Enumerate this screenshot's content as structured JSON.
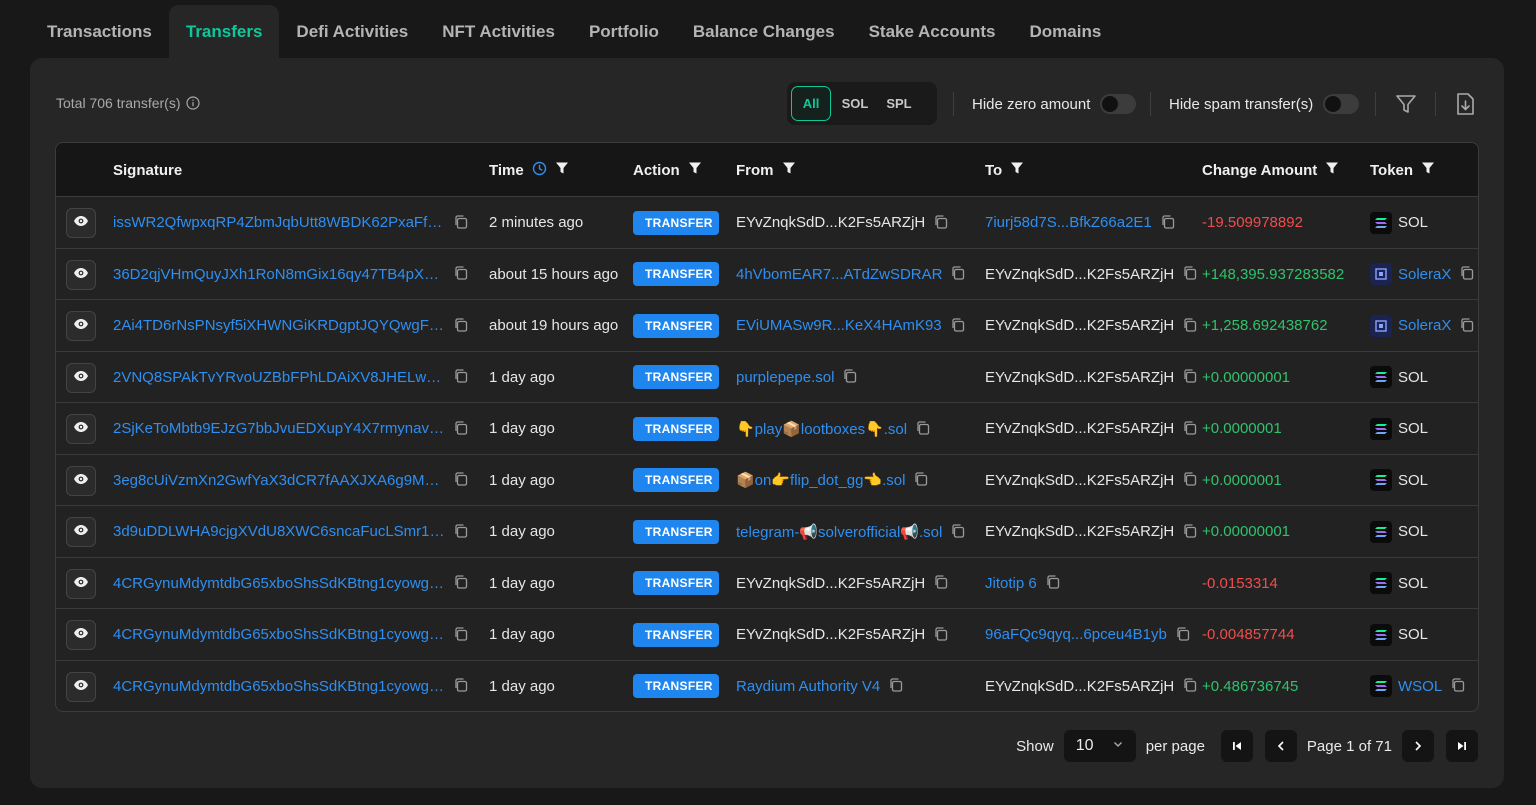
{
  "tabs": [
    {
      "label": "Transactions"
    },
    {
      "label": "Transfers",
      "active": true
    },
    {
      "label": "Defi Activities"
    },
    {
      "label": "NFT Activities"
    },
    {
      "label": "Portfolio"
    },
    {
      "label": "Balance Changes"
    },
    {
      "label": "Stake Accounts"
    },
    {
      "label": "Domains"
    }
  ],
  "toolbar": {
    "total": "Total 706 transfer(s)",
    "filters": [
      "All",
      "SOL",
      "SPL"
    ],
    "active_filter": "All",
    "hide_zero_label": "Hide zero amount",
    "hide_spam_label": "Hide spam transfer(s)",
    "hide_zero_on": false,
    "hide_spam_on": false
  },
  "columns": {
    "signature": "Signature",
    "time": "Time",
    "action": "Action",
    "from": "From",
    "to": "To",
    "amount": "Change Amount",
    "token": "Token"
  },
  "rows": [
    {
      "signature": "issWR2QfwpxqRP4ZbmJqbUtt8WBDK62PxaFfSU...",
      "time": "2 minutes ago",
      "action": "TRANSFER",
      "from": "EYvZnqkSdD...K2Fs5ARZjH",
      "from_link": false,
      "to": "7iurj58d7S...BfkZ66a2E1",
      "to_link": true,
      "amount": "-19.509978892",
      "sign": "neg",
      "token": "SOL",
      "token_link": false,
      "token_icon": "solana-icon"
    },
    {
      "signature": "36D2qjVHmQuyJXh1RoN8mGix16qy47TB4pXPA...",
      "time": "about 15 hours ago",
      "action": "TRANSFER",
      "from": "4hVbomEAR7...ATdZwSDRAR",
      "from_link": true,
      "to": "EYvZnqkSdD...K2Fs5ARZjH",
      "to_link": false,
      "amount": "+148,395.937283582",
      "sign": "pos",
      "token": "SoleraX",
      "token_link": true,
      "token_icon": "solerax-icon"
    },
    {
      "signature": "2Ai4TD6rNsPNsyf5iXHWNGiKRDgptJQYQwgFzvs...",
      "time": "about 19 hours ago",
      "action": "TRANSFER",
      "from": "EViUMASw9R...KeX4HAmK93",
      "from_link": true,
      "to": "EYvZnqkSdD...K2Fs5ARZjH",
      "to_link": false,
      "amount": "+1,258.692438762",
      "sign": "pos",
      "token": "SoleraX",
      "token_link": true,
      "token_icon": "solerax-icon"
    },
    {
      "signature": "2VNQ8SPAkTvYRvoUZBbFPhLDAiXV8JHELwuXA...",
      "time": "1 day ago",
      "action": "TRANSFER",
      "from": "purplepepe.sol",
      "from_link": true,
      "to": "EYvZnqkSdD...K2Fs5ARZjH",
      "to_link": false,
      "amount": "+0.00000001",
      "sign": "pos",
      "token": "SOL",
      "token_link": false,
      "token_icon": "solana-icon"
    },
    {
      "signature": "2SjKeToMbtb9EJzG7bbJvuEDXupY4X7rmynavKD...",
      "time": "1 day ago",
      "action": "TRANSFER",
      "from": "👇play📦lootboxes👇.sol",
      "from_link": true,
      "to": "EYvZnqkSdD...K2Fs5ARZjH",
      "to_link": false,
      "amount": "+0.0000001",
      "sign": "pos",
      "token": "SOL",
      "token_link": false,
      "token_icon": "solana-icon"
    },
    {
      "signature": "3eg8cUiVzmXn2GwfYaX3dCR7fAAXJXA6g9MZF...",
      "time": "1 day ago",
      "action": "TRANSFER",
      "from": "📦on👉flip_dot_gg👈.sol",
      "from_link": true,
      "to": "EYvZnqkSdD...K2Fs5ARZjH",
      "to_link": false,
      "amount": "+0.0000001",
      "sign": "pos",
      "token": "SOL",
      "token_link": false,
      "token_icon": "solana-icon"
    },
    {
      "signature": "3d9uDDLWHA9cjgXVdU8XWC6sncaFucLSmr1Ze...",
      "time": "1 day ago",
      "action": "TRANSFER",
      "from": "telegram-📢solverofficial📢.sol",
      "from_link": true,
      "to": "EYvZnqkSdD...K2Fs5ARZjH",
      "to_link": false,
      "amount": "+0.00000001",
      "sign": "pos",
      "token": "SOL",
      "token_link": false,
      "token_icon": "solana-icon"
    },
    {
      "signature": "4CRGynuMdymtdbG65xboShsSdKBtng1cyowgcx...",
      "time": "1 day ago",
      "action": "TRANSFER",
      "from": "EYvZnqkSdD...K2Fs5ARZjH",
      "from_link": false,
      "to": "Jitotip 6",
      "to_link": true,
      "amount": "-0.0153314",
      "sign": "neg",
      "token": "SOL",
      "token_link": false,
      "token_icon": "solana-icon"
    },
    {
      "signature": "4CRGynuMdymtdbG65xboShsSdKBtng1cyowgcx...",
      "time": "1 day ago",
      "action": "TRANSFER",
      "from": "EYvZnqkSdD...K2Fs5ARZjH",
      "from_link": false,
      "to": "96aFQc9qyq...6pceu4B1yb",
      "to_link": true,
      "amount": "-0.004857744",
      "sign": "neg",
      "token": "SOL",
      "token_link": false,
      "token_icon": "solana-icon"
    },
    {
      "signature": "4CRGynuMdymtdbG65xboShsSdKBtng1cyowgcx...",
      "time": "1 day ago",
      "action": "TRANSFER",
      "from": "Raydium Authority V4",
      "from_link": true,
      "to": "EYvZnqkSdD...K2Fs5ARZjH",
      "to_link": false,
      "amount": "+0.486736745",
      "sign": "pos",
      "token": "WSOL",
      "token_link": true,
      "token_icon": "solana-icon"
    }
  ],
  "pagination": {
    "show_label": "Show",
    "per_page_value": "10",
    "per_page_label": "per page",
    "page_text": "Page 1 of 71"
  },
  "colors": {
    "accent": "#10c79a",
    "link": "#2f8ff1",
    "badge": "#1f86f0",
    "negative": "#f04d4d",
    "positive": "#2fc36b"
  }
}
